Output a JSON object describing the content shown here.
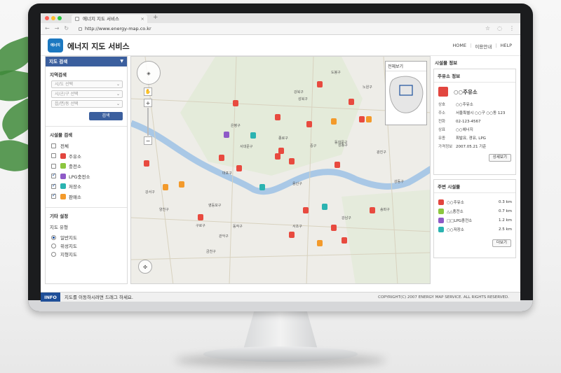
{
  "browser": {
    "tab_title": "에너지 지도 서비스",
    "new_tab": "+",
    "url": "http://www.energy-map.co.kr",
    "icons": [
      "back-icon",
      "forward-icon",
      "reload-icon",
      "star-icon",
      "extension-icon",
      "menu-icon"
    ]
  },
  "header": {
    "logo_text": "에너지",
    "title": "에너지 지도 서비스",
    "links": [
      "HOME",
      "이용안내",
      "HELP"
    ]
  },
  "sidebar": {
    "panel_title": "지도 검색",
    "region": {
      "title": "지역검색",
      "selects": [
        "시/도 선택",
        "시/군/구 선택",
        "읍/면/동 선택"
      ],
      "search_label": "검색"
    },
    "facility": {
      "title": "시설물 검색",
      "items": [
        {
          "label": "전체",
          "checked": false,
          "color": ""
        },
        {
          "label": "주유소",
          "checked": false,
          "color": "#e2463f"
        },
        {
          "label": "충전소",
          "checked": false,
          "color": "#8cc63f"
        },
        {
          "label": "LPG충전소",
          "checked": true,
          "color": "#8e5ac7"
        },
        {
          "label": "저장소",
          "checked": true,
          "color": "#2bb3b1"
        },
        {
          "label": "판매소",
          "checked": true,
          "color": "#f39a2b"
        }
      ]
    },
    "other": {
      "title": "기타 설정",
      "subtitle": "지도 유형",
      "options": [
        {
          "label": "일반지도",
          "selected": true
        },
        {
          "label": "위성지도",
          "selected": false
        },
        {
          "label": "지형지도",
          "selected": false
        }
      ]
    }
  },
  "map": {
    "overview_title": "전체보기",
    "labels": [
      "도봉구",
      "노원구",
      "강북구",
      "성북구",
      "중랑구",
      "은평구",
      "종로구",
      "동대문구",
      "서대문구",
      "중구",
      "성동구",
      "광진구",
      "마포구",
      "용산구",
      "강서구",
      "양천구",
      "영등포구",
      "강동구",
      "구로구",
      "동작구",
      "서초구",
      "강남구",
      "송파구",
      "관악구",
      "금천구"
    ]
  },
  "right": {
    "section_title": "시설물 정보",
    "info": {
      "title": "주유소 정보",
      "name": "○○주유소",
      "rows": [
        {
          "k": "상호",
          "v": "○○주유소"
        },
        {
          "k": "주소",
          "v": "서울특별시 ○○구 ○○동 123"
        },
        {
          "k": "전화",
          "v": "02-123-4567"
        },
        {
          "k": "상표",
          "v": "○○에너지"
        },
        {
          "k": "유종",
          "v": "휘발유, 경유, LPG"
        },
        {
          "k": "가격정보",
          "v": "2007.05.21 기준"
        }
      ],
      "detail_label": "상세보기"
    },
    "nearby": {
      "title": "주변 시설물",
      "items": [
        {
          "name": "○○주유소",
          "dist": "0.3 km",
          "color": "#e2463f"
        },
        {
          "name": "△△충전소",
          "dist": "0.7 km",
          "color": "#8cc63f"
        },
        {
          "name": "□□LPG충전소",
          "dist": "1.2 km",
          "color": "#8e5ac7"
        },
        {
          "name": "○○저장소",
          "dist": "2.5 km",
          "color": "#2bb3b1"
        }
      ],
      "more_label": "더보기"
    }
  },
  "status": {
    "tag": "INFO",
    "message": "지도를 이동하시려면 드래그 하세요.",
    "copyright": "COPYRIGHT(C) 2007 ENERGY MAP SERVICE. ALL RIGHTS RESERVED."
  }
}
